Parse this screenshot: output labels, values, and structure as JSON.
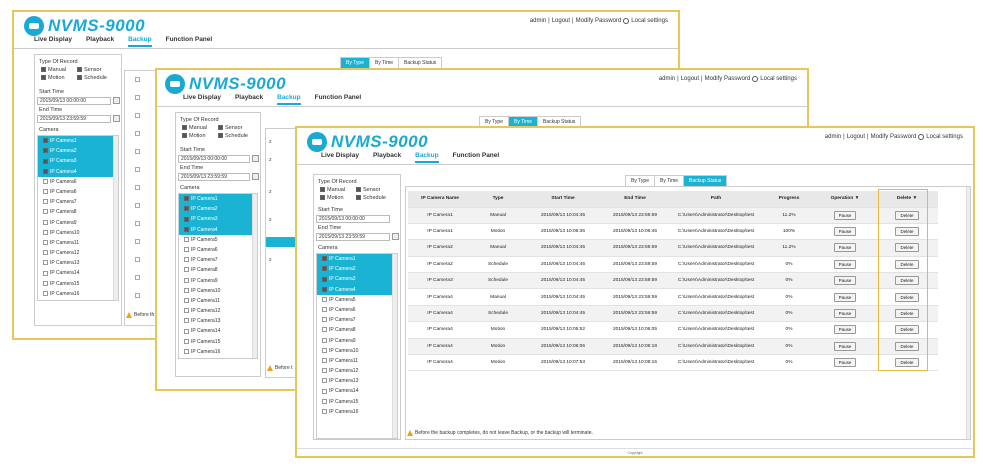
{
  "app": {
    "logo_text": "NVMS-9000",
    "user": "admin",
    "logout": "Logout",
    "modify_password": "Modify Password",
    "local_settings": "Local settings"
  },
  "nav": [
    "Live Display",
    "Playback",
    "Backup",
    "Function Panel"
  ],
  "record_type": {
    "label": "Type Of Record",
    "options": [
      {
        "label": "Manual",
        "checked": true
      },
      {
        "label": "Sensor",
        "checked": true
      },
      {
        "label": "Motion",
        "checked": true
      },
      {
        "label": "Schedule",
        "checked": true
      }
    ]
  },
  "start_time": {
    "label": "Start Time",
    "value": "2015/09/13 00:00:00"
  },
  "end_time": {
    "label": "End Time",
    "value": "2015/09/13 23:59:59"
  },
  "camera_label": "Camera",
  "cameras_w1": [
    "IP Camera1",
    "IP Camera2",
    "IP Camera3",
    "IP Camera4",
    "IP Camera6",
    "IP Camera6",
    "IP Camera7",
    "IP Camera8",
    "IP Camera9",
    "IP Camera10",
    "IP Camera11",
    "IP Camera12",
    "IP Camera13",
    "IP Camera14",
    "IP Camera15",
    "IP Camera16"
  ],
  "cameras_w2": [
    "IP Camera1",
    "IP Camera2",
    "IP Camera3",
    "IP Camera4",
    "IP Camera5",
    "IP Camera6",
    "IP Camera7",
    "IP Camera8",
    "IP Camera9",
    "IP Camera10",
    "IP Camera11",
    "IP Camera12",
    "IP Camera13",
    "IP Camera14",
    "IP Camera15",
    "IP Camera16"
  ],
  "cameras_w3": [
    "IP Camera1",
    "IP Camera2",
    "IP Camera3",
    "IP Camera4",
    "IP Camera5",
    "IP Camera6",
    "IP Camera7",
    "IP Camera8",
    "IP Camera9",
    "IP Camera10",
    "IP Camera11",
    "IP Camera12",
    "IP Camera13",
    "IP Camera14",
    "IP Camera15",
    "IP Camera16"
  ],
  "tabs": [
    "By Type",
    "By Time",
    "Backup Status"
  ],
  "table": {
    "headers": [
      "IP Camera Name",
      "Type",
      "Start Time",
      "End Time",
      "Path",
      "Progress",
      "Operation",
      "Delete"
    ],
    "rows": [
      [
        "IP Camera1",
        "Manual",
        "2015/09/13 10:04:45",
        "2015/09/13 23:59:59",
        "C:\\Users\\Administrator\\Desktop\\test",
        "11.2%",
        "Pause",
        "Delete"
      ],
      [
        "IP Camera1",
        "Motion",
        "2015/09/13 10:06:36",
        "2015/09/13 10:06:46",
        "C:\\Users\\Administrator\\Desktop\\test",
        "100%",
        "Pause",
        "Delete"
      ],
      [
        "IP Camera2",
        "Manual",
        "2015/09/13 10:04:45",
        "2015/09/13 23:59:59",
        "C:\\Users\\Administrator\\Desktop\\test",
        "11.2%",
        "Pause",
        "Delete"
      ],
      [
        "IP Camera2",
        "Schedule",
        "2015/09/13 10:04:45",
        "2015/09/13 23:59:59",
        "C:\\Users\\Administrator\\Desktop\\test",
        "0%",
        "Pause",
        "Delete"
      ],
      [
        "IP Camera3",
        "Schedule",
        "2015/09/13 10:04:45",
        "2015/09/13 23:59:59",
        "C:\\Users\\Administrator\\Desktop\\test",
        "0%",
        "Pause",
        "Delete"
      ],
      [
        "IP Camera4",
        "Manual",
        "2015/09/13 10:04:45",
        "2015/09/13 23:59:59",
        "C:\\Users\\Administrator\\Desktop\\test",
        "0%",
        "Pause",
        "Delete"
      ],
      [
        "IP Camera4",
        "Schedule",
        "2015/09/13 10:04:45",
        "2015/09/13 23:59:59",
        "C:\\Users\\Administrator\\Desktop\\test",
        "0%",
        "Pause",
        "Delete"
      ],
      [
        "IP Camera4",
        "Motion",
        "2015/09/13 10:05:52",
        "2015/09/13 10:06:05",
        "C:\\Users\\Administrator\\Desktop\\test",
        "0%",
        "Pause",
        "Delete"
      ],
      [
        "IP Camera4",
        "Motion",
        "2015/09/13 10:06:06",
        "2015/09/13 10:06:18",
        "C:\\Users\\Administrator\\Desktop\\test",
        "0%",
        "Pause",
        "Delete"
      ],
      [
        "IP Camera4",
        "Motion",
        "2015/09/13 10:07:53",
        "2015/09/13 10:08:15",
        "C:\\Users\\Administrator\\Desktop\\test",
        "0%",
        "Pause",
        "Delete"
      ]
    ]
  },
  "warning": "Before the backup completes, do not leave Backup, or the backup will terminate.",
  "warning_short": "Before th",
  "warning_short2": "Before t",
  "copyright": "Copyright",
  "colors": {
    "accent": "#1aa9d4",
    "highlight": "#e6b93a",
    "frame": "#e6c75a"
  }
}
